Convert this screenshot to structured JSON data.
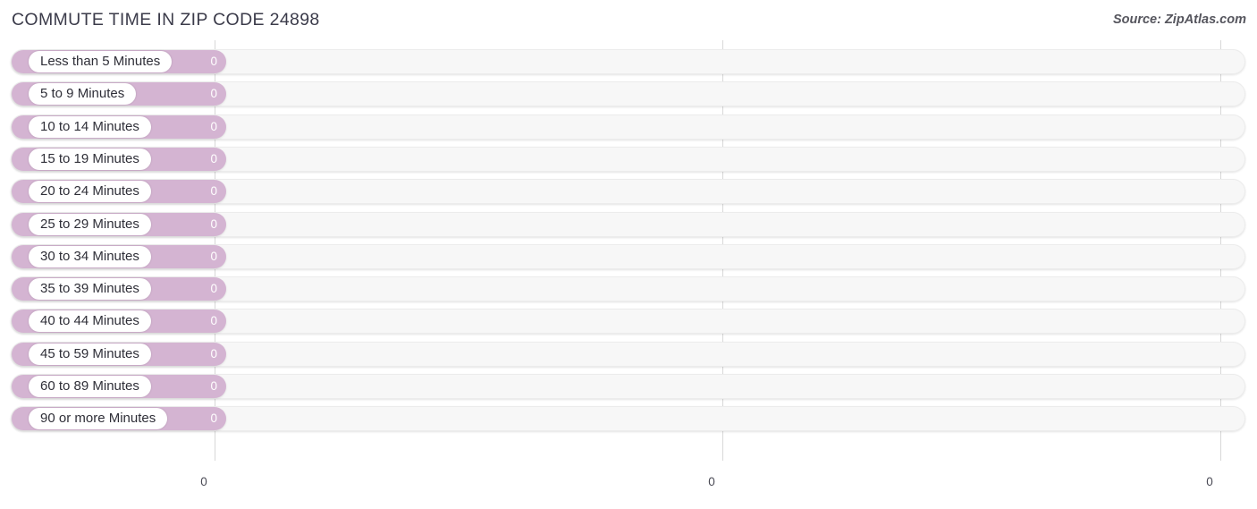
{
  "header": {
    "title": "COMMUTE TIME IN ZIP CODE 24898",
    "source": "Source: ZipAtlas.com"
  },
  "colors": {
    "bar": "#d4b4d2",
    "track": "#f7f7f7",
    "gridline": "#d8d8d8",
    "title_text": "#3b3b4a",
    "value_text": "#ffffff"
  },
  "chart_data": {
    "type": "bar",
    "orientation": "horizontal",
    "title": "COMMUTE TIME IN ZIP CODE 24898",
    "xlabel": "",
    "ylabel": "",
    "grid": true,
    "legend": null,
    "xlim": [
      0,
      0
    ],
    "axis_ticks": [
      "0",
      "0",
      "0"
    ],
    "categories": [
      "Less than 5 Minutes",
      "5 to 9 Minutes",
      "10 to 14 Minutes",
      "15 to 19 Minutes",
      "20 to 24 Minutes",
      "25 to 29 Minutes",
      "30 to 34 Minutes",
      "35 to 39 Minutes",
      "40 to 44 Minutes",
      "45 to 59 Minutes",
      "60 to 89 Minutes",
      "90 or more Minutes"
    ],
    "values": [
      0,
      0,
      0,
      0,
      0,
      0,
      0,
      0,
      0,
      0,
      0,
      0
    ],
    "value_labels": [
      "0",
      "0",
      "0",
      "0",
      "0",
      "0",
      "0",
      "0",
      "0",
      "0",
      "0",
      "0"
    ]
  }
}
